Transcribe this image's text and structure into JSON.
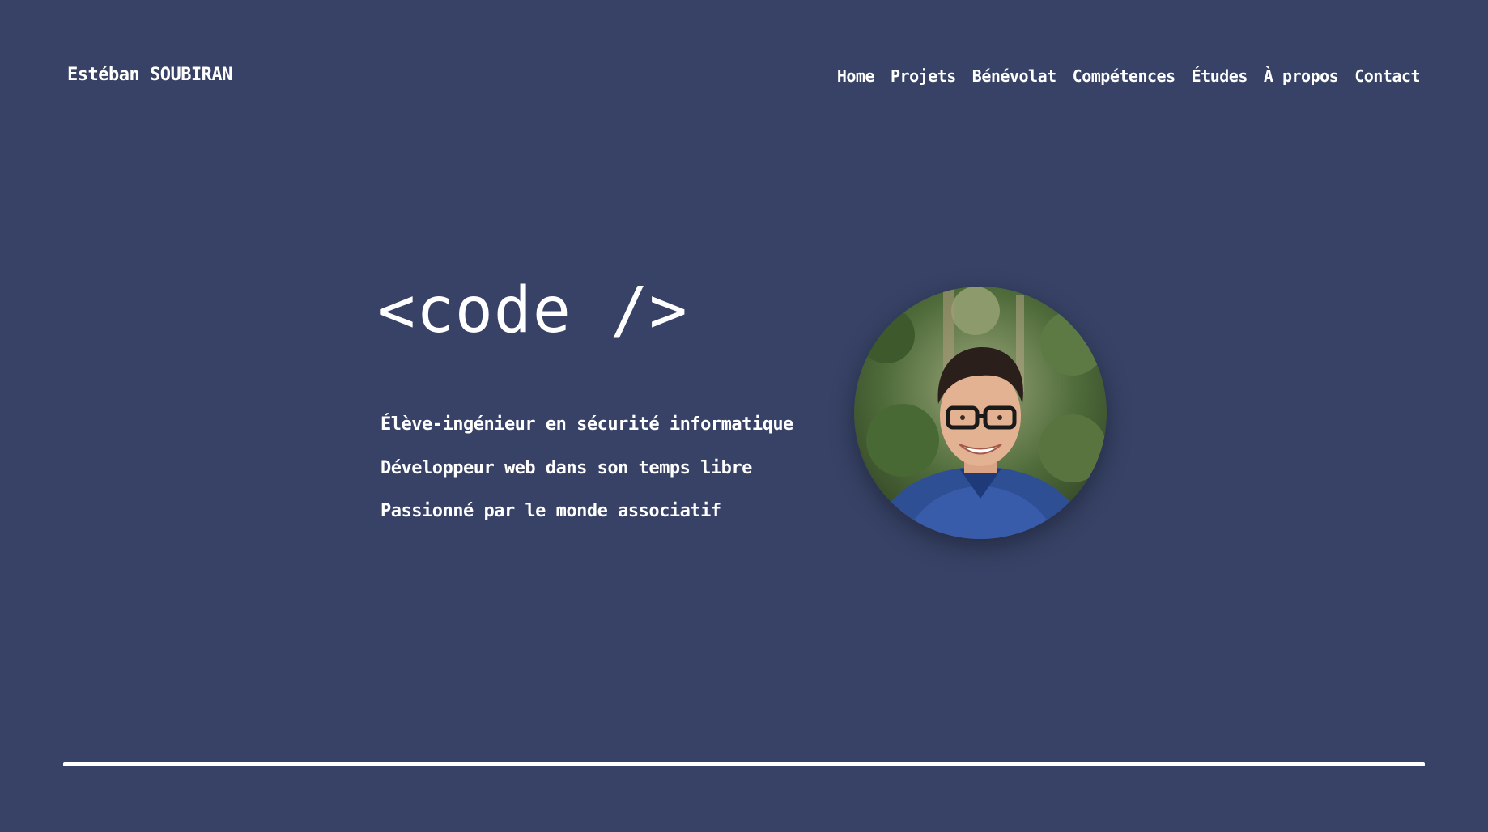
{
  "header": {
    "brand": "Estéban SOUBIRAN",
    "nav": [
      {
        "label": "Home"
      },
      {
        "label": "Projets"
      },
      {
        "label": "Bénévolat"
      },
      {
        "label": "Compétences"
      },
      {
        "label": "Études"
      },
      {
        "label": "À propos"
      },
      {
        "label": "Contact"
      }
    ]
  },
  "hero": {
    "title": "<code />",
    "taglines": [
      "Élève-ingénieur en sécurité informatique",
      "Développeur web dans son temps libre",
      "Passionné par le monde associatif"
    ]
  },
  "colors": {
    "background": "#374266",
    "text": "#ffffff"
  }
}
